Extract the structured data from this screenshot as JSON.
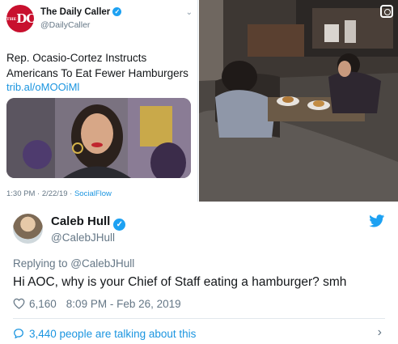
{
  "embedded_tweet": {
    "logo_text": "DC",
    "logo_small": "THE",
    "account_name": "The Daily Caller",
    "handle": "@DailyCaller",
    "text": "Rep. Ocasio-Cortez Instructs Americans To Eat Fewer Hamburgers",
    "link": "trib.al/oMOOiMl",
    "timestamp": "1:30 PM · 2/22/19 · ",
    "source": "SocialFlow"
  },
  "tweet": {
    "author_name": "Caleb Hull",
    "author_handle": "@CalebJHull",
    "reply_prefix": "Replying to ",
    "reply_mention": "@CalebJHull",
    "text": "Hi AOC, why is your Chief of Staff eating a hamburger? smh",
    "like_count": "6,160",
    "timestamp": "8:09 PM - Feb 26, 2019",
    "talking_text": "3,440 people are talking about this"
  },
  "icons": {
    "verified": "verified-badge-icon",
    "twitter": "twitter-bird-icon",
    "heart": "heart-icon",
    "bubble": "speech-bubble-icon",
    "chevron": "chevron-right-icon",
    "instagram": "instagram-icon"
  },
  "colors": {
    "twitter_blue": "#1da1f2",
    "link_blue": "#1b95e0",
    "text_secondary": "#657786",
    "daily_caller_red": "#c8102e"
  }
}
